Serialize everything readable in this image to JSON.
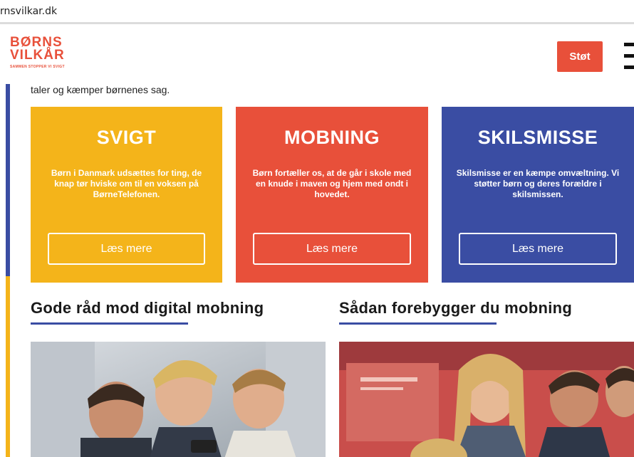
{
  "browser": {
    "url": "rnsvilkar.dk"
  },
  "header": {
    "logo_line1": "BØRNS",
    "logo_line2": "VILKÅR",
    "logo_tagline": "SAMMEN STOPPER VI SVIGT",
    "support_button": "Støt",
    "menu_icon": "hamburger-icon"
  },
  "intro_text": "taler og kæmper børnenes sag.",
  "cards": [
    {
      "title": "SVIGT",
      "text": "Børn i Danmark udsættes for ting, de knap tør hviske om til en voksen på BørneTelefonen.",
      "button": "Læs mere",
      "color": "#f4b41a"
    },
    {
      "title": "MOBNING",
      "text": "Børn fortæller os, at de går i skole med en knude i maven og hjem med ondt i hovedet.",
      "button": "Læs mere",
      "color": "#e8503a"
    },
    {
      "title": "SKILSMISSE",
      "text": "Skilsmisse er en kæmpe omvæltning. Vi støtter børn og deres forældre i skilsmissen.",
      "button": "Læs mere",
      "color": "#3a4da3"
    }
  ],
  "articles": [
    {
      "title": "Gode råd mod digital mobning"
    },
    {
      "title": "Sådan forebygger du mobning"
    }
  ],
  "colors": {
    "accent_red": "#e8503a",
    "accent_yellow": "#f4b41a",
    "accent_blue": "#3a4da3"
  }
}
